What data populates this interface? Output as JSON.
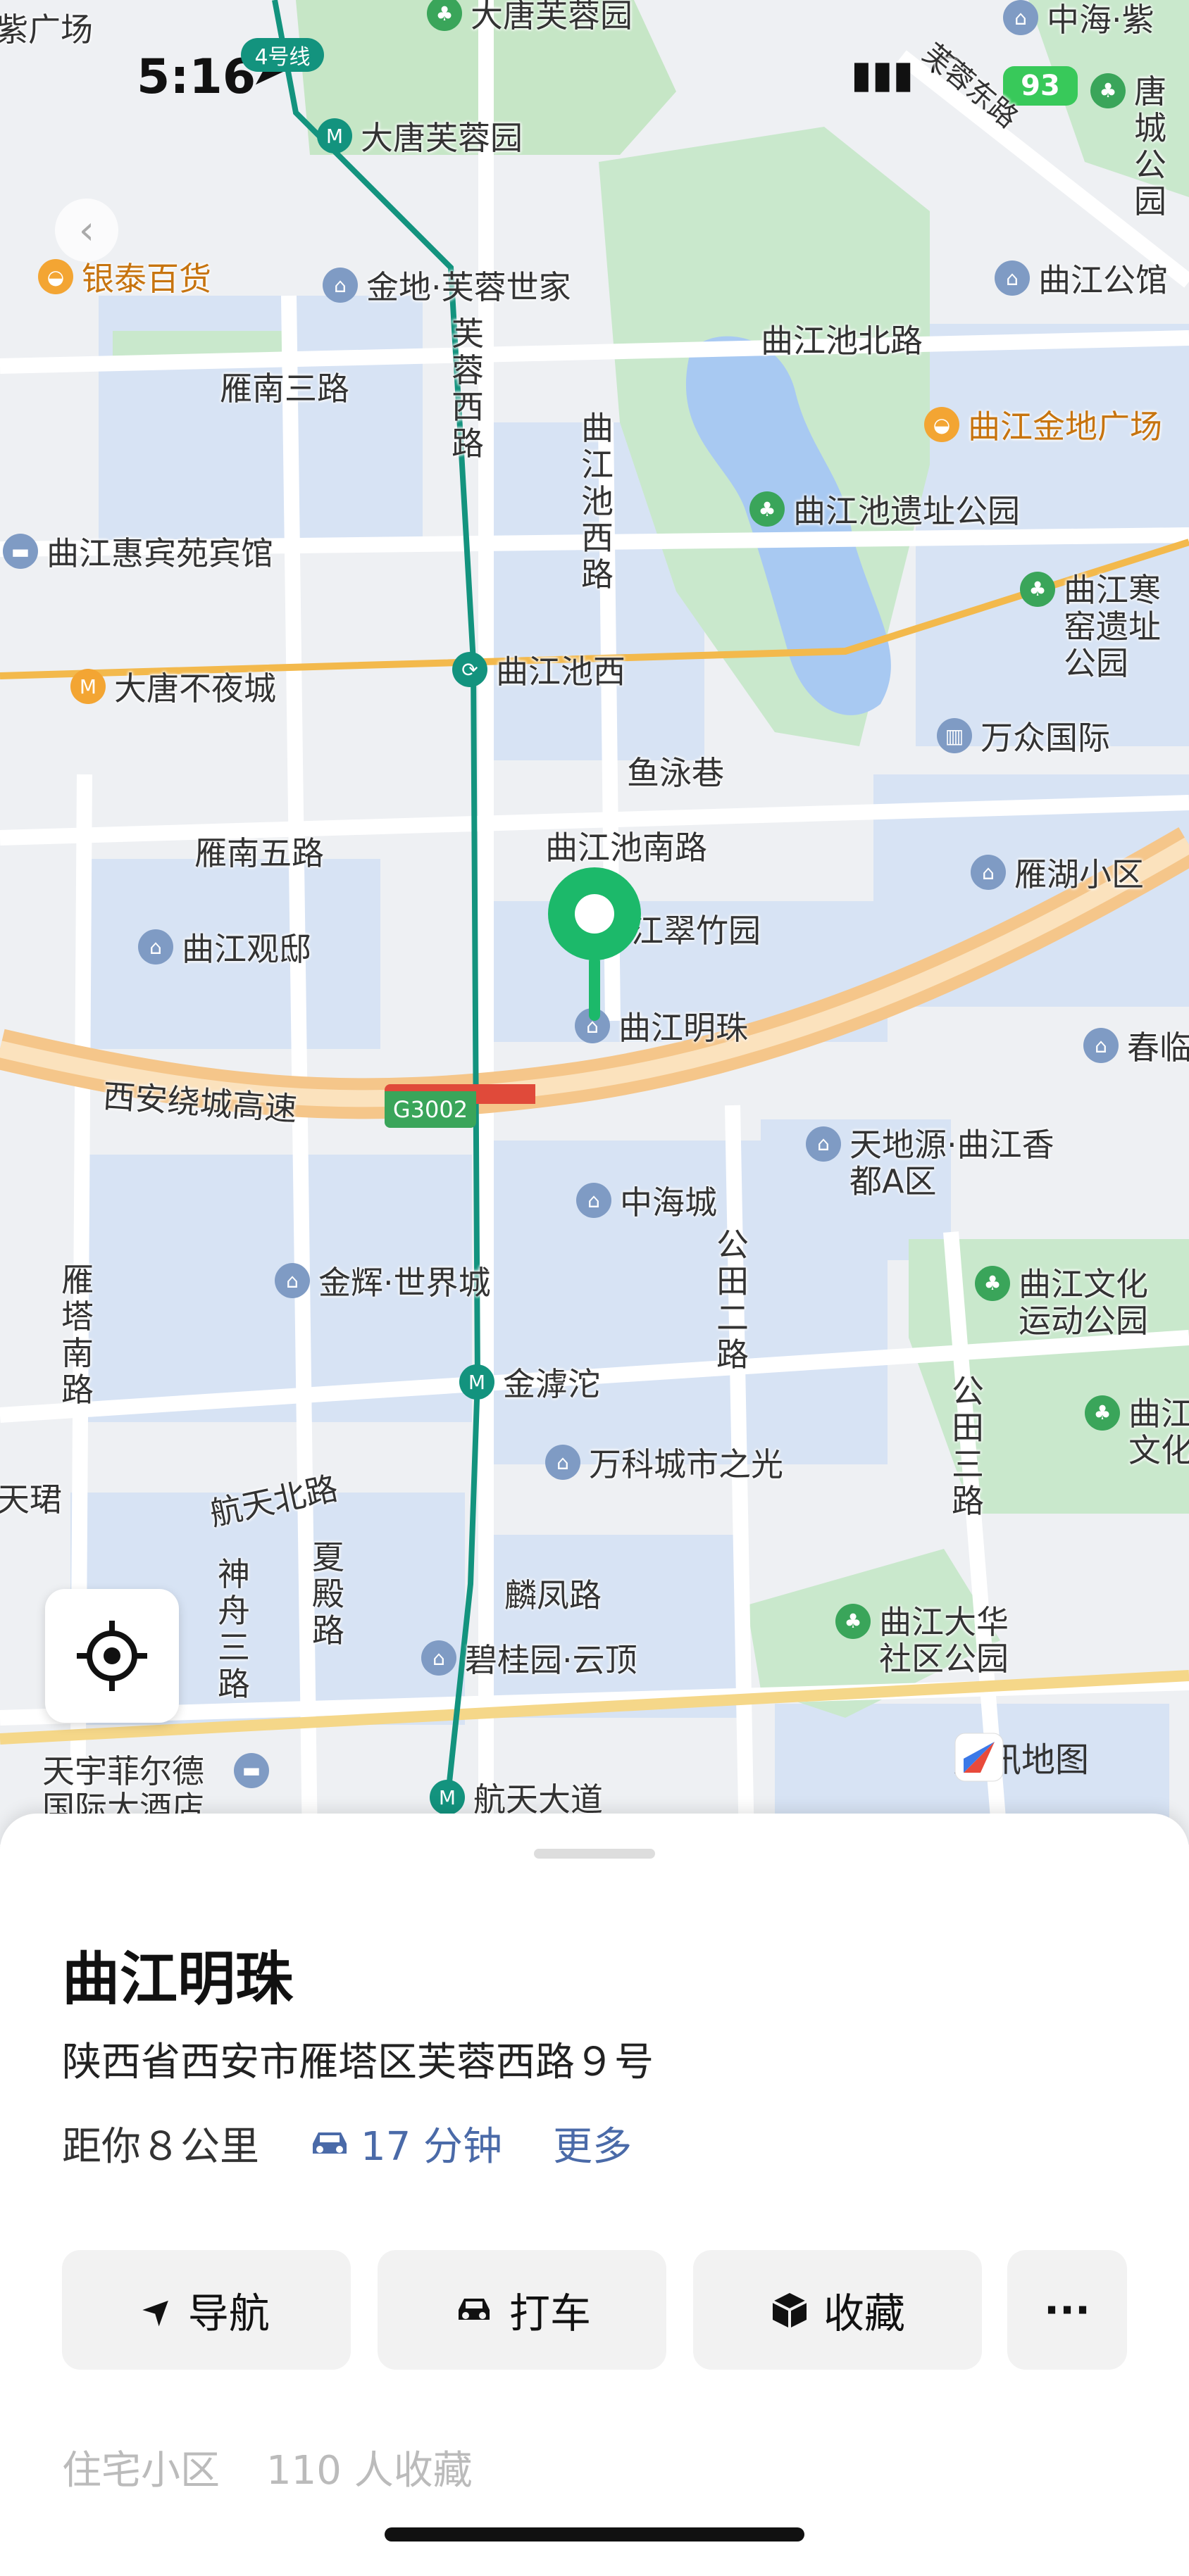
{
  "status_bar": {
    "time": "5:16",
    "battery": "93"
  },
  "map": {
    "metro_line": "4号线",
    "road_badge": "G3002",
    "watermark": "腾讯地图",
    "labels": {
      "top_left": "紫广场",
      "datang_furong": "大唐芙蓉园",
      "zhonghai_zi": "中海·紫",
      "furong_east": "芙蓉东路",
      "tang_park": "唐城公园",
      "intime": "银泰百货",
      "jindi_furong": "金地·芙蓉世家",
      "qujiang_hall": "曲江公馆",
      "yannan3": "雁南三路",
      "furong_west": "芙蓉西路",
      "qujiangchi_north": "曲江池北路",
      "qujiang_jindi": "曲江金地广场",
      "qujiangchi_west": "曲江池西路",
      "qujiangchi_park": "曲江池遗址公园",
      "huibin": "曲江惠宾苑宾馆",
      "hanhan": "曲江寒窑遗址公园",
      "datang_night": "大唐不夜城",
      "qujiangchi_west_station": "曲江池西",
      "wanzhong": "万众国际",
      "yuyong": "鱼泳巷",
      "yannan5": "雁南五路",
      "qujiangchi_south": "曲江池南路",
      "yanhu": "雁湖小区",
      "guandi": "曲江观邸",
      "cuizhu": "江翠竹园",
      "mingzhu": "曲江明珠",
      "chunlin": "春临",
      "ring_express": "西安绕城高速",
      "tiandi": "天地源·曲江香都A区",
      "zhonghai_city": "中海城",
      "gongtian2": "公田二路",
      "yanta_south": "雁塔南路",
      "jinhui": "金辉·世界城",
      "culture_sports": "曲江文化运动公园",
      "jinhutuo": "金滹沱",
      "gongtian3": "公田三路",
      "tianjun": "天珺",
      "vanke": "万科城市之光",
      "qujiang_culture": "曲江文化",
      "hangtian_north": "航天北路",
      "shenzhou3": "神舟三路",
      "xiadian": "夏殿路",
      "linfeng": "麟凤路",
      "dahua_park": "曲江大华社区公园",
      "biguiyuan": "碧桂园·云顶",
      "tianyu": "天宇菲尔德国际大酒店",
      "hangtian_station": "航天大道"
    }
  },
  "place": {
    "name": "曲江明珠",
    "address": "陕西省西安市雁塔区芙蓉西路９号",
    "distance": "距你８公里",
    "drive_time": "17 分钟",
    "more": "更多",
    "category": "住宅小区",
    "favorites": "110 人收藏"
  },
  "actions": {
    "navigate": "导航",
    "taxi": "打车",
    "collect": "收藏",
    "more": "···"
  },
  "colors": {
    "accent": "#1cb96a",
    "link": "#4a6aa8",
    "metro": "#13937e",
    "expressway": "#f5c68a"
  }
}
